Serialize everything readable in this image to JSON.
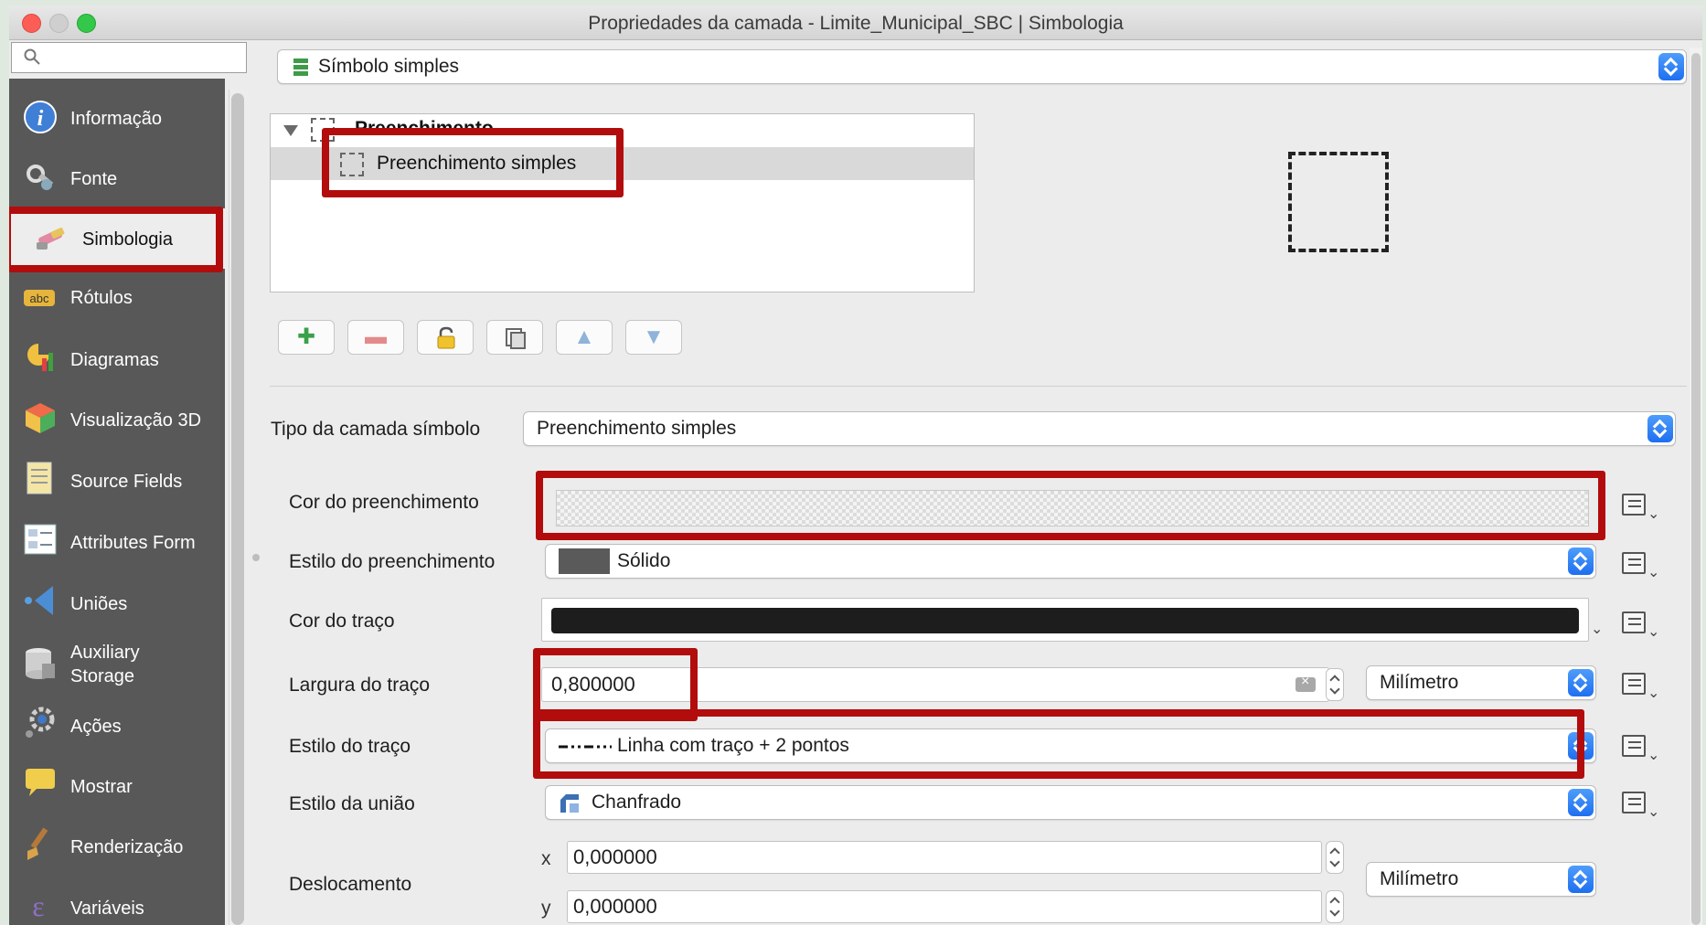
{
  "window": {
    "title": "Propriedades da camada - Limite_Municipal_SBC | Simbologia"
  },
  "search": {
    "placeholder": ""
  },
  "sidebar": {
    "items": [
      {
        "label": "Informação",
        "icon": "info-icon"
      },
      {
        "label": "Fonte",
        "icon": "source-wrench-icon"
      },
      {
        "label": "Simbologia",
        "icon": "paintbrush-icon"
      },
      {
        "label": "Rótulos",
        "icon": "abc-labels-icon"
      },
      {
        "label": "Diagramas",
        "icon": "diagram-icon"
      },
      {
        "label": "Visualização 3D",
        "icon": "cube-3d-icon"
      },
      {
        "label": "Source Fields",
        "icon": "fields-table-icon"
      },
      {
        "label": "Attributes Form",
        "icon": "form-icon"
      },
      {
        "label": "Uniões",
        "icon": "joins-icon"
      },
      {
        "label_line1": "Auxiliary",
        "label_line2": "Storage",
        "icon": "database-icon"
      },
      {
        "label": "Ações",
        "icon": "gear-actions-icon"
      },
      {
        "label": "Mostrar",
        "icon": "speech-bubble-icon"
      },
      {
        "label": "Renderização",
        "icon": "brush-render-icon"
      },
      {
        "label": "Variáveis",
        "icon": "epsilon-icon"
      }
    ]
  },
  "symbol_type": {
    "value": "Símbolo simples"
  },
  "tree": {
    "parent": "Preenchimento",
    "child": "Preenchimento simples"
  },
  "toolbar": {
    "buttons": [
      "add-layer",
      "remove-layer",
      "lock-layer",
      "duplicate-layer",
      "move-up",
      "move-down"
    ]
  },
  "form": {
    "symbol_layer_type_label": "Tipo da camada símbolo",
    "symbol_layer_type_value": "Preenchimento simples",
    "fill_color_label": "Cor do preenchimento",
    "fill_style_label": "Estilo do preenchimento",
    "fill_style_value": "Sólido",
    "stroke_color_label": "Cor do traço",
    "stroke_color": "#1d1d1d",
    "stroke_width_label": "Largura do traço",
    "stroke_width_value": "0,800000",
    "stroke_width_unit": "Milímetro",
    "stroke_style_label": "Estilo do traço",
    "stroke_style_value": "Linha com traço + 2 pontos",
    "join_style_label": "Estilo da união",
    "join_style_value": "Chanfrado",
    "offset_label": "Deslocamento",
    "offset_x_label": "x",
    "offset_x_value": "0,000000",
    "offset_y_label": "y",
    "offset_y_value": "0,000000",
    "offset_unit": "Milímetro"
  },
  "colors": {
    "highlight": "#b20c0c",
    "accent": "#1e6ff0",
    "sidebar_bg": "#585858"
  }
}
